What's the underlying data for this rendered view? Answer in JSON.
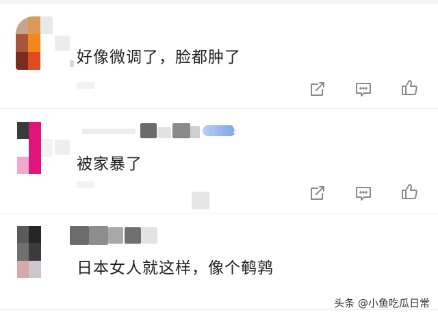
{
  "comments": [
    {
      "text": "好像微调了，脸都肿了"
    },
    {
      "text": "被家暴了",
      "badge_count": "1"
    },
    {
      "text": "日本女人就这样，像个鹌鹑"
    }
  ],
  "actions": {
    "share_icon": "share-icon",
    "reply_icon": "comment-icon",
    "like_icon": "thumbs-up-icon",
    "icon_color": "#8a8a8a"
  },
  "watermark": "头条 @小鱼吃瓜日常"
}
